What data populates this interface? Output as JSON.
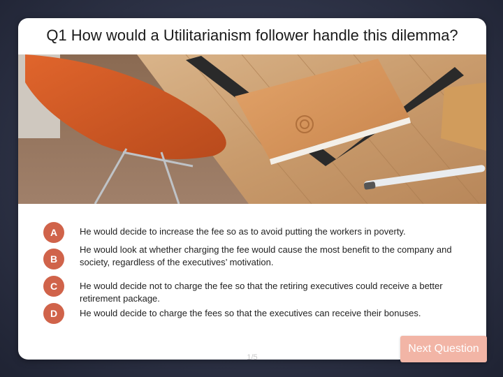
{
  "question": {
    "title": "Q1 How would a Utilitarianism follower handle this dilemma?"
  },
  "answers": [
    {
      "letter": "A",
      "text": "He would decide to increase the fee so as to avoid putting the workers in poverty."
    },
    {
      "letter": "B",
      "text": "He would look at whether charging the fee would cause the most benefit to the company and society, regardless of the executives’ motivation."
    },
    {
      "letter": "C",
      "text": "He would decide not to charge the fee so that the retiring executives could receive a better retirement package."
    },
    {
      "letter": "D",
      "text": "He would decide to charge the fees so that the executives can receive their bonuses."
    }
  ],
  "footer": {
    "page_indicator": "1/5",
    "next_label": "Next Question"
  },
  "colors": {
    "accent": "#d0634a",
    "next_button": "#f2b5a6"
  }
}
